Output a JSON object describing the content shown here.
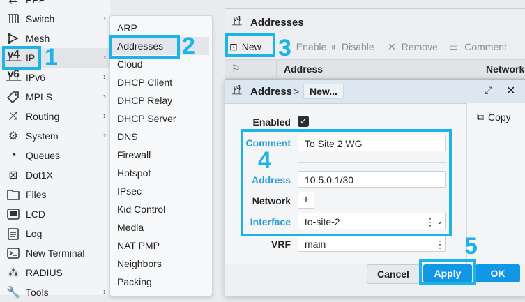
{
  "main_menu": {
    "items": [
      {
        "label": "PPP",
        "icon": "ppp-icon",
        "has_arrow": false
      },
      {
        "label": "Switch",
        "icon": "switch-icon",
        "has_arrow": true
      },
      {
        "label": "Mesh",
        "icon": "mesh-icon",
        "has_arrow": false
      },
      {
        "label": "IP",
        "icon": "ip-v4-icon",
        "has_arrow": true
      },
      {
        "label": "IPv6",
        "icon": "ipv6-icon",
        "has_arrow": true
      },
      {
        "label": "MPLS",
        "icon": "mpls-icon",
        "has_arrow": true
      },
      {
        "label": "Routing",
        "icon": "routing-icon",
        "has_arrow": true
      },
      {
        "label": "System",
        "icon": "system-gear-icon",
        "has_arrow": true
      },
      {
        "label": "Queues",
        "icon": "queues-icon",
        "has_arrow": false
      },
      {
        "label": "Dot1X",
        "icon": "dot1x-icon",
        "has_arrow": false
      },
      {
        "label": "Files",
        "icon": "folder-icon",
        "has_arrow": false
      },
      {
        "label": "LCD",
        "icon": "lcd-icon",
        "has_arrow": false
      },
      {
        "label": "Log",
        "icon": "log-icon",
        "has_arrow": false
      },
      {
        "label": "New Terminal",
        "icon": "terminal-icon",
        "has_arrow": false
      },
      {
        "label": "RADIUS",
        "icon": "radius-icon",
        "has_arrow": false
      },
      {
        "label": "Tools",
        "icon": "tools-icon",
        "has_arrow": true
      }
    ]
  },
  "ip_submenu": {
    "items": [
      "ARP",
      "Addresses",
      "Cloud",
      "DHCP Client",
      "DHCP Relay",
      "DHCP Server",
      "DNS",
      "Firewall",
      "Hotspot",
      "IPsec",
      "Kid Control",
      "Media",
      "NAT PMP",
      "Neighbors",
      "Packing"
    ]
  },
  "addresses_window": {
    "title": "Addresses",
    "toolbar": {
      "new": "New",
      "enable": "Enable",
      "disable": "Disable",
      "remove": "Remove",
      "comment": "Comment"
    },
    "columns": [
      "Address",
      "Network"
    ]
  },
  "dialog": {
    "title": "Address",
    "breadcrumb_sep": ">",
    "breadcrumb_chip": "New...",
    "copy_label": "Copy",
    "fields": {
      "enabled_label": "Enabled",
      "enabled_checked": true,
      "comment_label": "Comment",
      "comment_value": "To Site 2 WG",
      "address_label": "Address",
      "address_value": "10.5.0.1/30",
      "network_label": "Network",
      "network_add": "+",
      "interface_label": "Interface",
      "interface_value": "to-site-2",
      "vrf_label": "VRF",
      "vrf_value": "main"
    },
    "buttons": {
      "cancel": "Cancel",
      "apply": "Apply",
      "ok": "OK"
    }
  },
  "annotations": {
    "step1": "1",
    "step2": "2",
    "step3": "3",
    "step4": "4",
    "step5": "5"
  },
  "colors": {
    "accent": "#1ab4e8",
    "button_blue": "#1296e6",
    "label_blue": "#2a9fd6"
  }
}
